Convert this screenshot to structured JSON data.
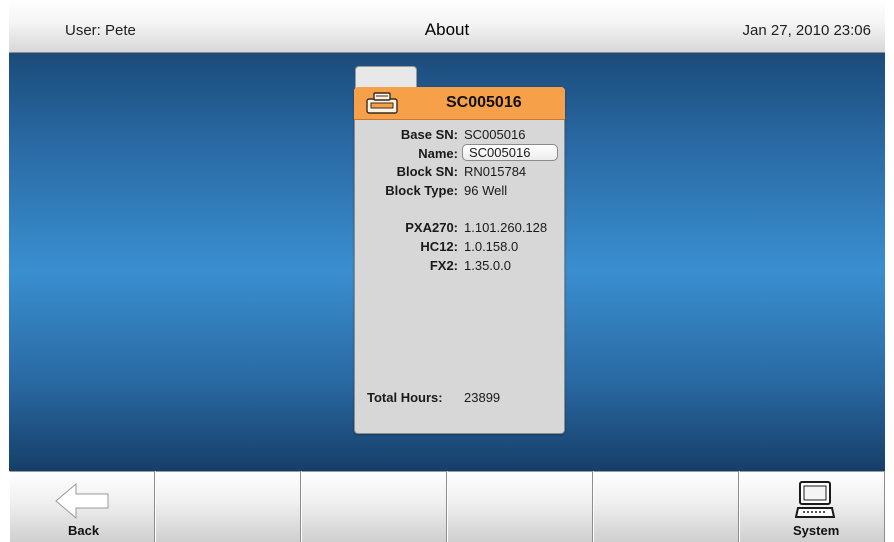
{
  "header": {
    "user": "User: Pete",
    "title": "About",
    "datetime": "Jan 27, 2010 23:06"
  },
  "card": {
    "serial": "SC005016",
    "icon": "instrument-icon",
    "rows": [
      {
        "label": "Base SN:",
        "value": "SC005016"
      },
      {
        "label": "Name:",
        "value": "SC005016"
      },
      {
        "label": "Block SN:",
        "value": "RN015784"
      },
      {
        "label": "Block Type:",
        "value": "96 Well"
      },
      {
        "label": "PXA270:",
        "value": "1.101.260.128"
      },
      {
        "label": "HC12:",
        "value": "1.0.158.0"
      },
      {
        "label": "FX2:",
        "value": "1.35.0.0"
      },
      {
        "label": "Total Hours:",
        "value": "23899"
      }
    ]
  },
  "toolbar": {
    "buttons": [
      {
        "label": "Back",
        "icon": "back-arrow-icon"
      },
      {
        "label": "",
        "icon": ""
      },
      {
        "label": "",
        "icon": ""
      },
      {
        "label": "",
        "icon": ""
      },
      {
        "label": "",
        "icon": ""
      },
      {
        "label": "System",
        "icon": "computer-icon"
      }
    ]
  },
  "colors": {
    "accent_orange": "#f6a14a",
    "background_blue": "#2a6aa4",
    "card_gray": "#d7d7d7"
  }
}
